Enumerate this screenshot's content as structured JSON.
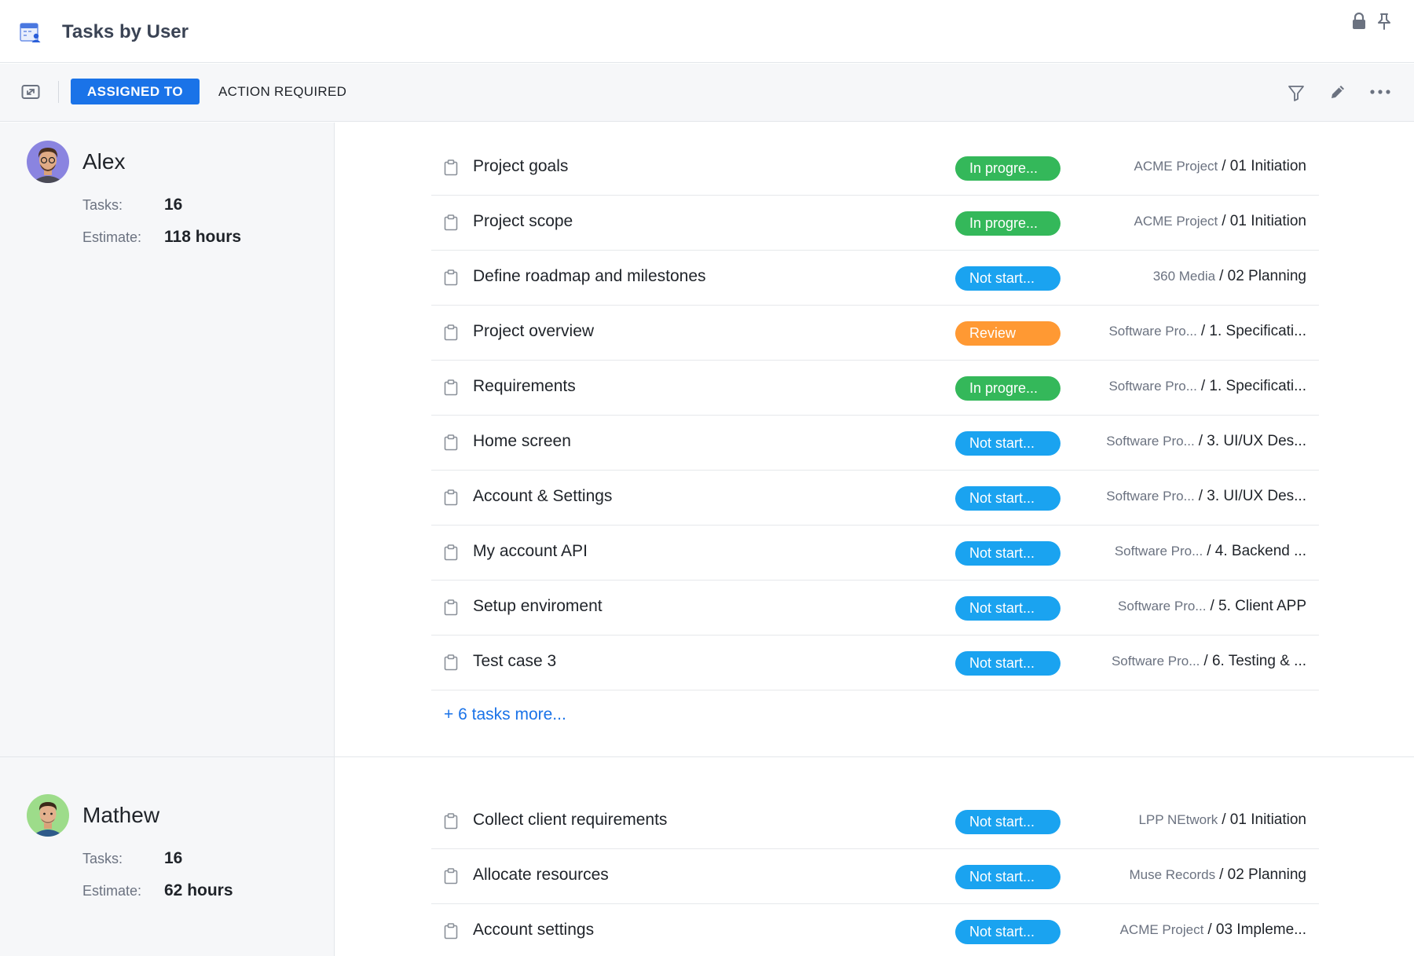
{
  "window": {
    "title": "Tasks by User",
    "icon": "calendar-user-icon",
    "right_icons": [
      "lock-icon",
      "pin-icon"
    ]
  },
  "toolbar": {
    "tab_assigned": "ASSIGNED TO",
    "tab_action": "ACTION REQUIRED",
    "active_tab": "ASSIGNED TO",
    "icons": [
      "expand-icon",
      "filter-icon",
      "edit-icon",
      "more-icon"
    ]
  },
  "colors": {
    "accent": "#1a73e8",
    "in_progress": "#34b85a",
    "not_started": "#1aa3f0",
    "review": "#ff9933"
  },
  "users": [
    {
      "name": "Alex",
      "tasks_label": "Tasks:",
      "tasks_value": "16",
      "estimate_label": "Estimate:",
      "estimate_value": "118 hours",
      "more_link": "+ 6 tasks more...",
      "tasks": [
        {
          "name": "Project goals",
          "status": "In progre...",
          "status_type": "in_progress",
          "project": "ACME Project",
          "phase": "/ 01 Initiation"
        },
        {
          "name": "Project scope",
          "status": "In progre...",
          "status_type": "in_progress",
          "project": "ACME Project",
          "phase": "/ 01 Initiation"
        },
        {
          "name": "Define roadmap and milestones",
          "status": "Not start...",
          "status_type": "not_started",
          "project": "360 Media",
          "phase": "/ 02 Planning"
        },
        {
          "name": "Project overview",
          "status": "Review",
          "status_type": "review",
          "project": "Software Pro...",
          "phase": "/ 1. Specificati..."
        },
        {
          "name": "Requirements",
          "status": "In progre...",
          "status_type": "in_progress",
          "project": "Software Pro...",
          "phase": "/ 1. Specificati..."
        },
        {
          "name": "Home screen",
          "status": "Not start...",
          "status_type": "not_started",
          "project": "Software Pro...",
          "phase": "/ 3. UI/UX Des..."
        },
        {
          "name": "Account & Settings",
          "status": "Not start...",
          "status_type": "not_started",
          "project": "Software Pro...",
          "phase": "/ 3. UI/UX Des..."
        },
        {
          "name": "My account API",
          "status": "Not start...",
          "status_type": "not_started",
          "project": "Software Pro...",
          "phase": "/ 4. Backend ..."
        },
        {
          "name": "Setup enviroment",
          "status": "Not start...",
          "status_type": "not_started",
          "project": "Software Pro...",
          "phase": "/ 5. Client APP"
        },
        {
          "name": "Test case 3",
          "status": "Not start...",
          "status_type": "not_started",
          "project": "Software Pro...",
          "phase": "/ 6. Testing & ..."
        }
      ]
    },
    {
      "name": "Mathew",
      "tasks_label": "Tasks:",
      "tasks_value": "16",
      "estimate_label": "Estimate:",
      "estimate_value": "62 hours",
      "tasks": [
        {
          "name": "Collect client requirements",
          "status": "Not start...",
          "status_type": "not_started",
          "project": "LPP NEtwork",
          "phase": "/ 01 Initiation"
        },
        {
          "name": "Allocate resources",
          "status": "Not start...",
          "status_type": "not_started",
          "project": "Muse Records",
          "phase": "/ 02 Planning"
        },
        {
          "name": "Account settings",
          "status": "Not start...",
          "status_type": "not_started",
          "project": "ACME Project",
          "phase": "/ 03 Impleme..."
        }
      ]
    }
  ]
}
